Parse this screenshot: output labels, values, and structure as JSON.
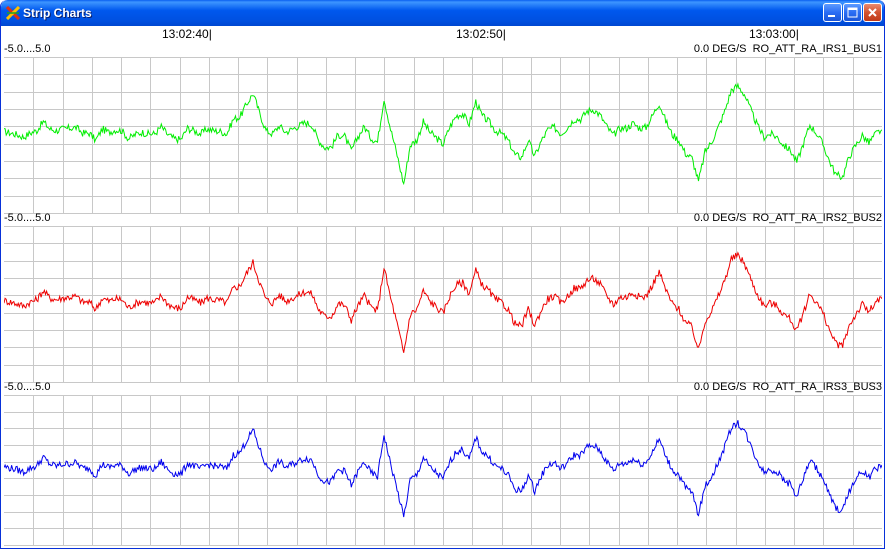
{
  "window": {
    "title": "Strip Charts"
  },
  "time_axis": {
    "ticks": [
      "13:02:40|",
      "13:02:50|",
      "13:03:00|"
    ]
  },
  "strips": [
    {
      "range": "-5.0....5.0",
      "value": "0.0",
      "units": "DEG/S",
      "channel": "RO_ATT_RA_IRS1_BUS1",
      "color": "#00ee00"
    },
    {
      "range": "-5.0....5.0",
      "value": "0.0",
      "units": "DEG/S",
      "channel": "RO_ATT_RA_IRS2_BUS2",
      "color": "#ee0000"
    },
    {
      "range": "-5.0....5.0",
      "value": "0.0",
      "units": "DEG/S",
      "channel": "RO_ATT_RA_IRS3_BUS3",
      "color": "#0000ee"
    }
  ],
  "chart_data": {
    "type": "line",
    "y_range": [
      -5.0,
      5.0
    ],
    "units": "DEG/S",
    "grid": true,
    "x_tick_labels": [
      "13:02:40",
      "13:02:50",
      "13:03:00"
    ],
    "series": [
      {
        "name": "RO_ATT_RA_IRS1_BUS1",
        "values": [
          0.25,
          0.15,
          0.05,
          -0.1,
          0.15,
          0.3,
          0.85,
          0.4,
          0.3,
          0.4,
          0.45,
          0.5,
          0.15,
          0.15,
          -0.3,
          0.4,
          0.2,
          0.35,
          0.3,
          -0.2,
          0.05,
          0.2,
          0.1,
          0.1,
          0.55,
          0.05,
          -0.2,
          -0.25,
          0.45,
          0.3,
          0.1,
          0.4,
          0.3,
          0.25,
          0.1,
          1.0,
          1.15,
          1.9,
          2.6,
          1.4,
          0.3,
          0.1,
          0.6,
          0.2,
          0.4,
          0.6,
          0.8,
          0.65,
          -0.3,
          -0.75,
          -0.7,
          0.05,
          -0.05,
          -0.95,
          -0.1,
          0.55,
          -0.15,
          -0.4,
          2.3,
          0.4,
          -1.2,
          -3.0,
          -0.6,
          -0.3,
          0.85,
          0.2,
          -0.15,
          -0.55,
          0.5,
          1.2,
          1.35,
          0.7,
          2.1,
          1.2,
          0.85,
          0.3,
          0.1,
          -0.35,
          -1.2,
          -1.35,
          -0.3,
          -1.3,
          -0.35,
          0.35,
          0.5,
          0.1,
          0.5,
          1.0,
          1.0,
          1.5,
          1.6,
          1.25,
          0.55,
          0.0,
          0.45,
          0.45,
          0.75,
          0.45,
          0.5,
          1.25,
          2.0,
          0.9,
          0.05,
          -0.3,
          -1.1,
          -1.4,
          -2.85,
          -1.0,
          -0.4,
          0.5,
          1.5,
          2.8,
          3.05,
          2.55,
          1.55,
          0.6,
          -0.1,
          0.1,
          -0.1,
          -0.6,
          -0.9,
          -1.65,
          -0.5,
          0.65,
          0.15,
          -0.55,
          -1.6,
          -2.45,
          -2.55,
          -1.3,
          -0.6,
          0.0,
          -0.45,
          0.1,
          0.35
        ]
      },
      {
        "name": "RO_ATT_RA_IRS2_BUS2",
        "values": [
          0.25,
          0.15,
          0.05,
          -0.1,
          0.15,
          0.3,
          0.85,
          0.4,
          0.3,
          0.4,
          0.45,
          0.5,
          0.15,
          0.15,
          -0.3,
          0.4,
          0.2,
          0.35,
          0.3,
          -0.2,
          0.05,
          0.2,
          0.1,
          0.1,
          0.55,
          0.05,
          -0.2,
          -0.25,
          0.45,
          0.3,
          0.1,
          0.4,
          0.3,
          0.25,
          0.1,
          1.0,
          1.15,
          1.9,
          2.6,
          1.4,
          0.3,
          0.1,
          0.6,
          0.2,
          0.4,
          0.6,
          0.8,
          0.65,
          -0.3,
          -0.75,
          -0.7,
          0.05,
          -0.05,
          -0.95,
          -0.1,
          0.55,
          -0.15,
          -0.4,
          2.3,
          0.4,
          -1.2,
          -3.0,
          -0.6,
          -0.3,
          0.85,
          0.2,
          -0.15,
          -0.55,
          0.5,
          1.2,
          1.35,
          0.7,
          2.1,
          1.2,
          0.85,
          0.3,
          0.1,
          -0.35,
          -1.2,
          -1.35,
          -0.3,
          -1.3,
          -0.35,
          0.35,
          0.5,
          0.1,
          0.5,
          1.0,
          1.0,
          1.5,
          1.6,
          1.25,
          0.55,
          0.0,
          0.45,
          0.45,
          0.75,
          0.45,
          0.5,
          1.25,
          2.0,
          0.9,
          0.05,
          -0.3,
          -1.1,
          -1.4,
          -2.85,
          -1.0,
          -0.4,
          0.5,
          1.5,
          2.8,
          3.05,
          2.55,
          1.55,
          0.6,
          -0.1,
          0.1,
          -0.1,
          -0.6,
          -0.9,
          -1.65,
          -0.5,
          0.65,
          0.15,
          -0.55,
          -1.6,
          -2.45,
          -2.55,
          -1.3,
          -0.6,
          0.0,
          -0.45,
          0.1,
          0.35
        ]
      },
      {
        "name": "RO_ATT_RA_IRS3_BUS3",
        "values": [
          0.25,
          0.15,
          0.05,
          -0.1,
          0.15,
          0.3,
          0.85,
          0.4,
          0.3,
          0.4,
          0.45,
          0.5,
          0.15,
          0.15,
          -0.3,
          0.4,
          0.2,
          0.35,
          0.3,
          -0.2,
          0.05,
          0.2,
          0.1,
          0.1,
          0.55,
          0.05,
          -0.2,
          -0.25,
          0.45,
          0.3,
          0.1,
          0.4,
          0.3,
          0.25,
          0.1,
          1.0,
          1.15,
          1.9,
          2.6,
          1.4,
          0.3,
          0.1,
          0.6,
          0.2,
          0.4,
          0.6,
          0.8,
          0.65,
          -0.3,
          -0.75,
          -0.7,
          0.05,
          -0.05,
          -0.95,
          -0.1,
          0.55,
          -0.15,
          -0.4,
          2.3,
          0.4,
          -1.2,
          -3.0,
          -0.6,
          -0.3,
          0.85,
          0.2,
          -0.15,
          -0.55,
          0.5,
          1.2,
          1.35,
          0.7,
          2.1,
          1.2,
          0.85,
          0.3,
          0.1,
          -0.35,
          -1.2,
          -1.35,
          -0.3,
          -1.3,
          -0.35,
          0.35,
          0.5,
          0.1,
          0.5,
          1.0,
          1.0,
          1.5,
          1.6,
          1.25,
          0.55,
          0.0,
          0.45,
          0.45,
          0.75,
          0.45,
          0.5,
          1.25,
          2.0,
          0.9,
          0.05,
          -0.3,
          -1.1,
          -1.4,
          -2.85,
          -1.0,
          -0.4,
          0.5,
          1.5,
          2.8,
          3.05,
          2.55,
          1.55,
          0.6,
          -0.1,
          0.1,
          -0.1,
          -0.6,
          -0.9,
          -1.65,
          -0.5,
          0.65,
          0.15,
          -0.55,
          -1.6,
          -2.45,
          -2.55,
          -1.3,
          -0.6,
          0.0,
          -0.45,
          0.1,
          0.35
        ]
      }
    ]
  }
}
